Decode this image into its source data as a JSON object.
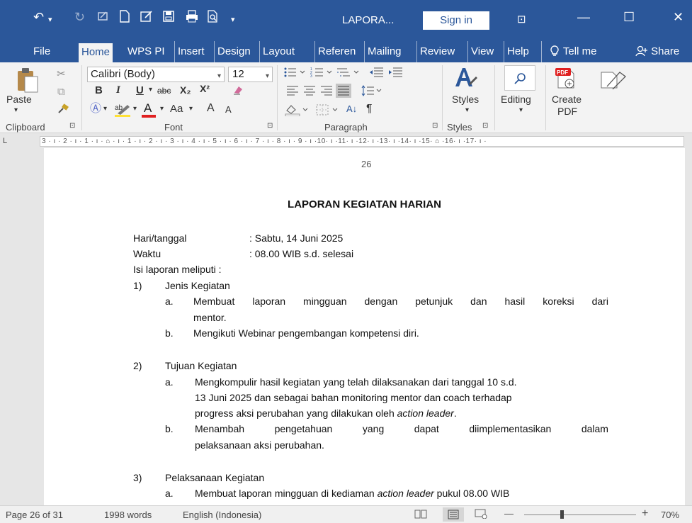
{
  "titlebar": {
    "title": "LAPORA...",
    "signin": "Sign in",
    "undo": "↶",
    "undo_dd": "▾",
    "redo": "↻",
    "qat_dd": "▾",
    "minimize": "—",
    "maximize": "☐",
    "close": "✕",
    "ribbon_display": "⊡"
  },
  "tabs": [
    "File",
    "Home",
    "WPS PI",
    "Insert",
    "Design",
    "Layout",
    "Referen",
    "Mailing",
    "Review",
    "View",
    "Help"
  ],
  "tellme": "Tell me",
  "share": "Share",
  "ribbon": {
    "clipboard": {
      "paste": "Paste",
      "paste_dd": "▾",
      "label": "Clipboard",
      "launcher": "⊡"
    },
    "font": {
      "name": "Calibri (Body)",
      "size": "12",
      "bold": "B",
      "italic": "I",
      "underline": "U",
      "strike": "abc",
      "subscript": "X₂",
      "superscript": "X²",
      "case": "Aa",
      "grow": "A",
      "shrink": "A",
      "color": "A",
      "label": "Font"
    },
    "paragraph": {
      "label": "Paragraph",
      "sort": "A↓",
      "pilcrow": "¶"
    },
    "styles": {
      "label": "Styles",
      "button": "Styles"
    },
    "editing": {
      "button": "Editing"
    },
    "pdf": {
      "create": "Create",
      "pdf": "PDF",
      "pdf_badge": "PDF"
    }
  },
  "ruler_text": "3 · ı · 2 · ı · 1 · ı · ⌂ · ı · 1 · ı · 2 · ı · 3 · ı · 4 · ı · 5 · ı · 6 · ı · 7 · ı · 8 · ı · 9 · ı ·10· ı ·11· ı ·12· ı ·13· ı ·14· ı ·15· ⌂ ·16· ı ·17· ı ·",
  "ruler_corner": "L",
  "document": {
    "page_number": "26",
    "title": "LAPORAN KEGIATAN HARIAN",
    "hari_label": "Hari/tanggal",
    "hari_value": ": Sabtu, 14 Juni 2025",
    "waktu_label": "Waktu",
    "waktu_value": ": 08.00 WIB s.d. selesai",
    "isi": "Isi laporan meliputi  :",
    "s1_num": "1)",
    "s1_title": "Jenis Kegiatan",
    "s1_a_letter": "a.",
    "s1_a_line1": [
      "Membuat",
      "laporan",
      "mingguan",
      "dengan",
      "petunjuk",
      "dan",
      "hasil",
      "koreksi",
      "dari"
    ],
    "s1_a_line2": "mentor.",
    "s1_b_letter": "b.",
    "s1_b_line1": "Mengikuti Webinar pengembangan kompetensi diri.",
    "s2_num": "2)",
    "s2_title": "Tujuan Kegiatan",
    "s2_a_letter": "a.",
    "s2_a_line1": "Mengkompulir hasil kegiatan yang telah dilaksanakan dari tanggal 10 s.d.",
    "s2_a_line2": "13 Juni 2025 dan sebagai bahan monitoring mentor dan coach terhadap",
    "s2_a_line3_pre": "progress aksi perubahan yang dilakukan oleh ",
    "s2_a_line3_em": "action leader",
    "s2_a_line3_post": ".",
    "s2_b_letter": "b.",
    "s2_b_line1": [
      "Menambah",
      "pengetahuan",
      "yang",
      "dapat",
      "diimplementasikan",
      "dalam"
    ],
    "s2_b_line2": "pelaksanaan aksi perubahan.",
    "s3_num": "3)",
    "s3_title": "Pelaksanaan Kegiatan",
    "s3_a_letter": "a.",
    "s3_a_pre": "Membuat laporan mingguan di kediaman ",
    "s3_a_em": "action leader",
    "s3_a_post": " pukul 08.00 WIB"
  },
  "status": {
    "page": "Page 26 of 31",
    "words": "1998 words",
    "language": "English (Indonesia)",
    "zoom": "70%",
    "zoom_minus": "—",
    "zoom_plus": "+",
    "zoom_level": 0.7
  },
  "colors": {
    "brand": "#2b579a",
    "accent_red": "#e02020",
    "highlight_yellow": "#ffe135"
  }
}
